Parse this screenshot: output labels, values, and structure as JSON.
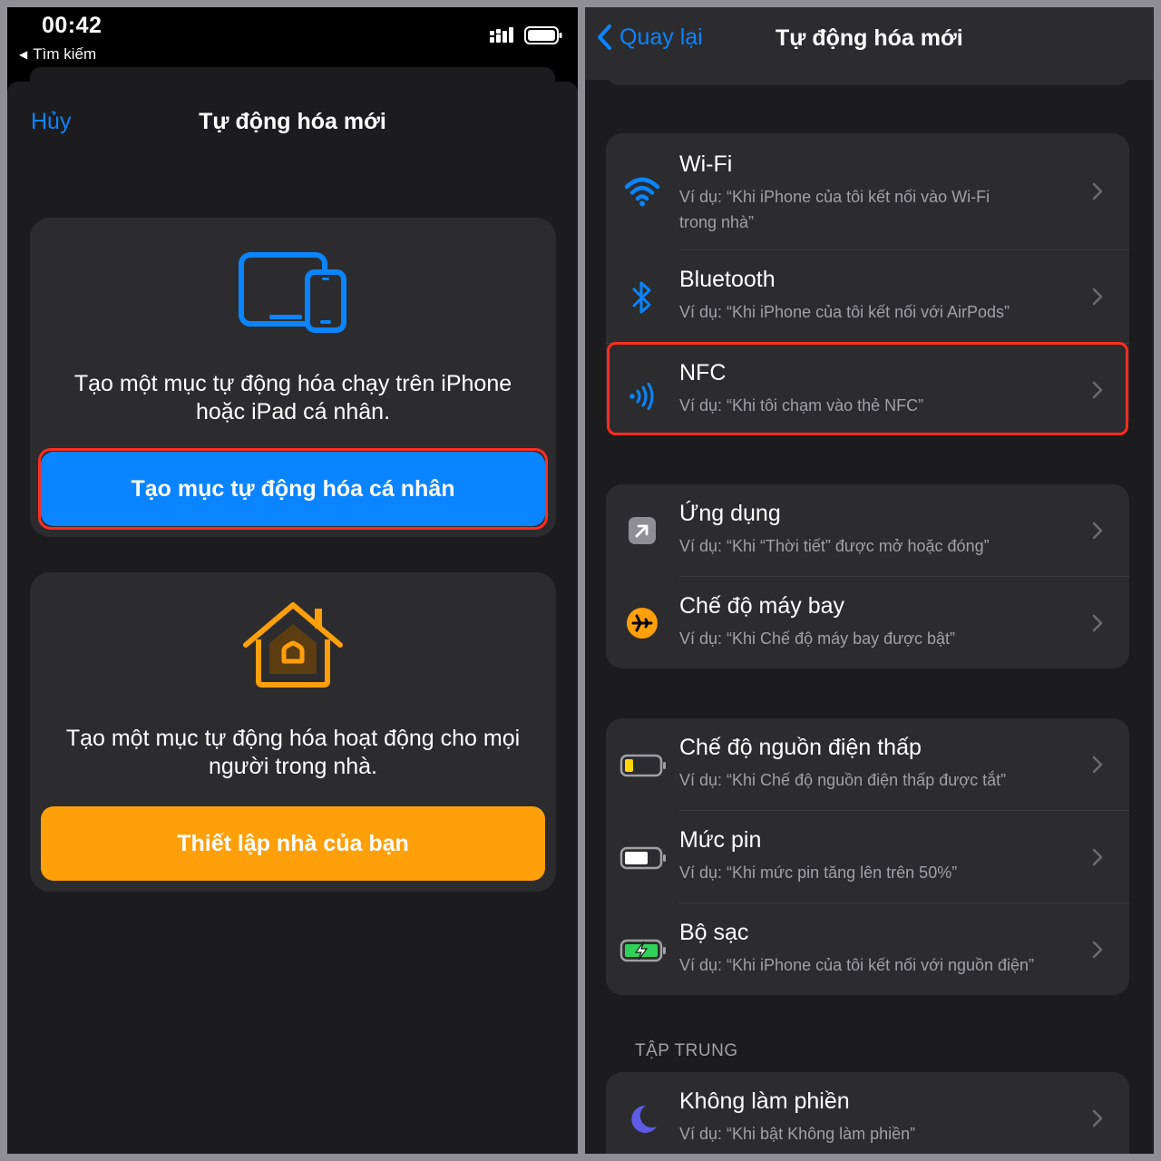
{
  "left": {
    "status": {
      "time": "00:42",
      "back_app": "Tìm kiếm"
    },
    "nav": {
      "cancel": "Hủy",
      "title": "Tự động hóa mới"
    },
    "personal_card": {
      "text_line1": "Tạo một mục tự động hóa chạy trên iPhone",
      "text_line2": "hoặc iPad cá nhân.",
      "button": "Tạo mục tự động hóa cá nhân",
      "accent": "#0a84ff"
    },
    "home_card": {
      "text_line1": "Tạo một mục tự động hóa hoạt động cho mọi",
      "text_line2": "người trong nhà.",
      "button": "Thiết lập nhà của bạn",
      "accent": "#ff9f0a"
    }
  },
  "right": {
    "nav": {
      "back": "Quay lại",
      "title": "Tự động hóa mới"
    },
    "group1": [
      {
        "title": "Wi-Fi",
        "sub_line1": "Ví dụ: “Khi iPhone của tôi kết nối vào Wi-Fi",
        "sub_line2": "trong nhà”",
        "icon": "wifi-icon"
      },
      {
        "title": "Bluetooth",
        "sub_line1": "Ví dụ: “Khi iPhone của tôi kết nối với AirPods”",
        "icon": "bluetooth-icon"
      },
      {
        "title": "NFC",
        "sub_line1": "Ví dụ: “Khi tôi chạm vào thẻ NFC”",
        "icon": "nfc-icon"
      }
    ],
    "group2": [
      {
        "title": "Ứng dụng",
        "sub_line1": "Ví dụ: “Khi “Thời tiết” được mở hoặc đóng”",
        "icon": "app-arrow-icon"
      },
      {
        "title": "Chế độ máy bay",
        "sub_line1": "Ví dụ: “Khi Chế độ máy bay được bật”",
        "icon": "airplane-icon"
      }
    ],
    "group3": [
      {
        "title": "Chế độ nguồn điện thấp",
        "sub_line1": "Ví dụ: “Khi Chế độ nguồn điện thấp được tắt”",
        "icon": "low-battery-icon"
      },
      {
        "title": "Mức pin",
        "sub_line1": "Ví dụ: “Khi mức pin tăng lên trên 50%”",
        "icon": "battery-icon"
      },
      {
        "title": "Bộ sạc",
        "sub_line1": "Ví dụ: “Khi iPhone của tôi kết nối với nguồn điện”",
        "icon": "charging-battery-icon"
      }
    ],
    "section_focus": "TẬP TRUNG",
    "group4": [
      {
        "title": "Không làm phiền",
        "sub_line1": "Ví dụ: “Khi bật Không làm phiền”",
        "icon": "moon-icon"
      }
    ],
    "colors": {
      "blue": "#0a84ff",
      "orange": "#ff9f0a",
      "yellow": "#ffd60a",
      "green": "#30d158",
      "purple": "#5e5ce6",
      "highlight": "#ff2d20"
    }
  }
}
